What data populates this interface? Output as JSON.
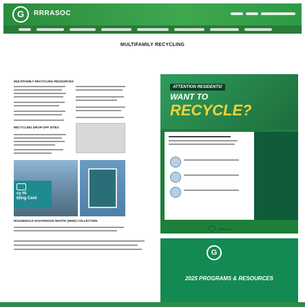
{
  "header": {
    "logo_letter": "G",
    "site_name": "RRRASOC"
  },
  "page": {
    "title": "MULTIFAMILY RECYCLING"
  },
  "left_columns": {
    "col1_heading": "MULTIFAMILY RECYCLING RESOURCES",
    "col1b_heading": "RECYCLING DROP-OFF SITES",
    "bottom_heading": "HOUSEHOLD HAZARDOUS WASTE (HHW) COLLECTION",
    "photo_sign_text": "c​y Hi\nbling Cent"
  },
  "flyer": {
    "banner": "ATTENTION RESIDENTS!",
    "want_to": "WANT TO",
    "recycle": "RECYCLE?",
    "logo_text": "RRRASOC"
  },
  "green_block": {
    "logo_letter": "G",
    "text": "2025 PROGRAMS & RESOURCES"
  },
  "colors": {
    "brand_green": "#2b8b3e",
    "accent_yellow": "#f4d23a",
    "dark_green": "#138a52"
  }
}
